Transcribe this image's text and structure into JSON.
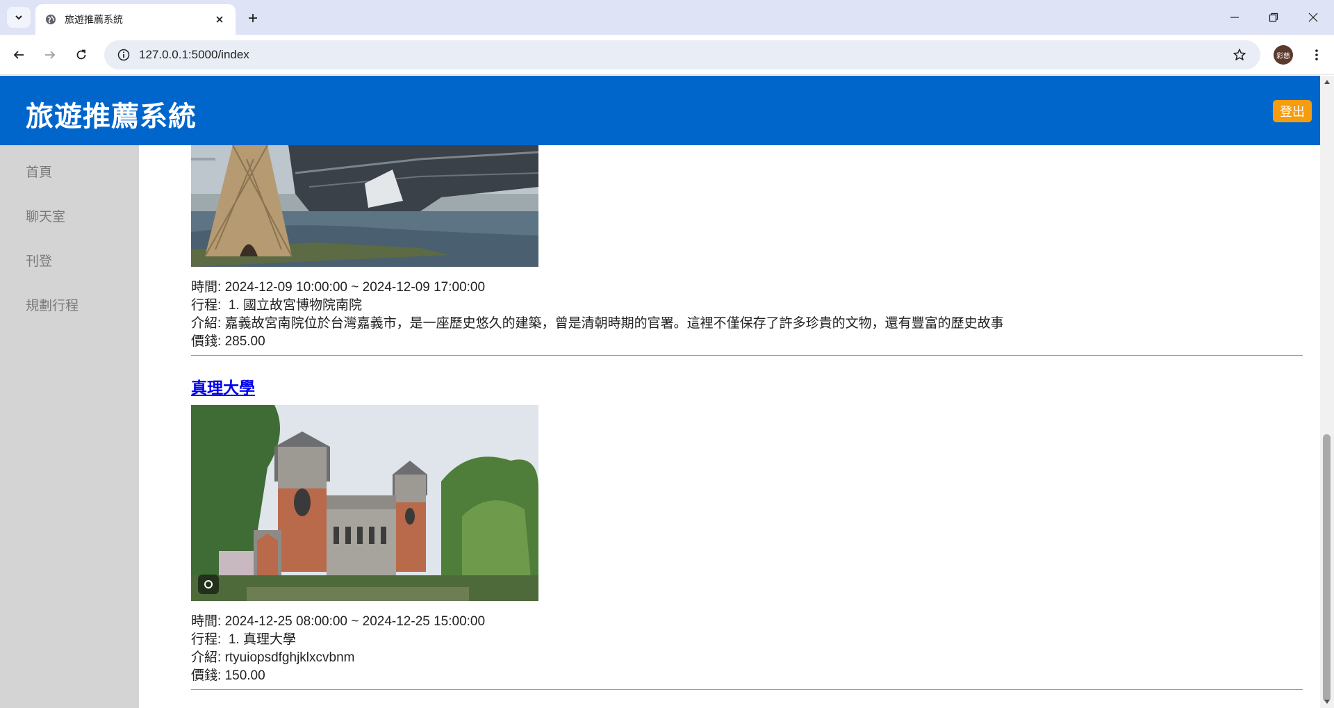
{
  "browser": {
    "tab_title": "旅遊推薦系統",
    "url": "127.0.0.1:5000/index",
    "avatar_text": "彩慈"
  },
  "header": {
    "title": "旅遊推薦系統",
    "logout_label": "登出"
  },
  "sidebar": {
    "items": [
      {
        "label": "首頁"
      },
      {
        "label": "聊天室"
      },
      {
        "label": "刊登"
      },
      {
        "label": "規劃行程"
      }
    ]
  },
  "posts": [
    {
      "time_label": "時間:",
      "time": "2024-12-09 10:00:00 ~ 2024-12-09 17:00:00",
      "itinerary_label": "行程:",
      "itinerary": "1. 國立故宮博物院南院",
      "intro_label": "介紹:",
      "intro": "嘉義故宮南院位於台灣嘉義市，是一座歷史悠久的建築，曾是清朝時期的官署。這裡不僅保存了許多珍貴的文物，還有豐富的歷史故事",
      "price_label": "價錢:",
      "price": "285.00"
    },
    {
      "title": "真理大學",
      "time_label": "時間:",
      "time": "2024-12-25 08:00:00 ~ 2024-12-25 15:00:00",
      "itinerary_label": "行程:",
      "itinerary": "1. 真理大學",
      "intro_label": "介紹:",
      "intro": "rtyuiopsdfghjklxcvbnm",
      "price_label": "價錢:",
      "price": "150.00"
    }
  ],
  "colors": {
    "header_bg": "#0066cc",
    "logout_bg": "#f59c0f",
    "sidebar_bg": "#d4d4d4",
    "link": "#0000ee"
  }
}
